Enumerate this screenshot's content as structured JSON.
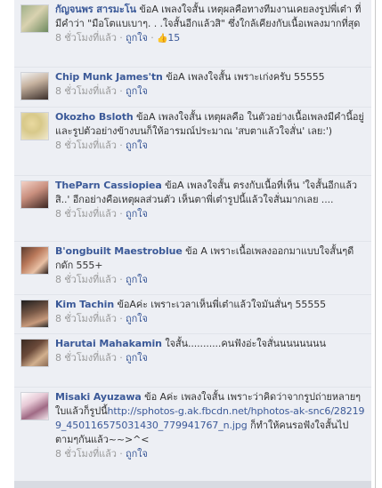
{
  "comments": [
    {
      "author": "กัญจนพร สารมะโน",
      "text": "ข้อA เพลงใจสั้น เหตุผลคือทางทีมงานเคยลงรูปพี่เต๋า ที่มีคำว่า \"มือโตแบเบาๆ. . .ใจสั้นอีกแล้วสิ\" ซึ่งใกล้เคียงกับเนื้อเพลงมากที่สุด",
      "time": "8 ชั่วโมงที่แล้ว",
      "like": "ถูกใจ",
      "likes": "15"
    },
    {
      "author": "Chip Munk James'tn",
      "text": "ข้อA เพลงใจสั้น เพราะเก่งครับ 55555",
      "time": "8 ชั่วโมงที่แล้ว",
      "like": "ถูกใจ"
    },
    {
      "author": "Okozho Bsloth",
      "text": "ข้อA เพลงใจสั้น เหตุผลคือ ในตัวอย่างเนื้อเพลงมีคำนี้อยู่ และรูปตัวอย่างข้างบนก็ให้อารมณ์ประมาณ 'สบตาแล้วใจสั่น' เลย:')",
      "time": "8 ชั่วโมงที่แล้ว",
      "like": "ถูกใจ"
    },
    {
      "author": "TheParn Cassiopiea",
      "text": "ข้อA เพลงใจสั้น ตรงกับเนื้อที่เห็น 'ใจสั้นอีกแล้วสิ..' อีกอย่างคือเหตุผลส่วนตัว เห็นตาพี่เต๋ารูปนี้แล้วใจสั่นมากเลย ....",
      "time": "8 ชั่วโมงที่แล้ว",
      "like": "ถูกใจ"
    },
    {
      "author": "B'ongbuilt Maestroblue",
      "text": "ข้อ A เพราะเนื้อเพลงออกมาแบบใจสั้นๆดีกดัก 555+",
      "time": "8 ชั่วโมงที่แล้ว",
      "like": "ถูกใจ"
    },
    {
      "author": "Kim Tachin",
      "text": "ข้อAค่ะ เพราะเวลาเห็นพี่เต๋าแล้วใจมันสั่นๆ 55555",
      "time": "8 ชั่วโมงที่แล้ว",
      "like": "ถูกใจ"
    },
    {
      "author": "Harutai Mahakamin",
      "text": "ใจสั้น...........คนฟังอ่ะใจสั่นนนนนนนน",
      "time": "8 ชั่วโมงที่แล้ว",
      "like": "ถูกใจ"
    },
    {
      "author": "Misaki Ayuzawa",
      "text_before": "ข้อ Aค่ะ เพลงใจสั้น เพราะว่าคิดว่าจากรูปถ่ายหลายๆใบแล้วก็รูปนี้",
      "url": "http://sphotos-g.ak.fbcdn.net/hphotos-ak-snc6/282199_450116575031430_779941767_n.jpg",
      "text_after": "ก็ทำให้คนรอฟังใจสั้นไปตามๆกันแล้ว~~>^<",
      "time": "8 ชั่วโมงที่แล้ว",
      "like": "ถูกใจ"
    }
  ],
  "separator": "·",
  "icons": {
    "thumbs-up": "👍"
  },
  "colors": {
    "link": "#3b5998",
    "meta": "#999999",
    "panel": "#edeff4"
  }
}
